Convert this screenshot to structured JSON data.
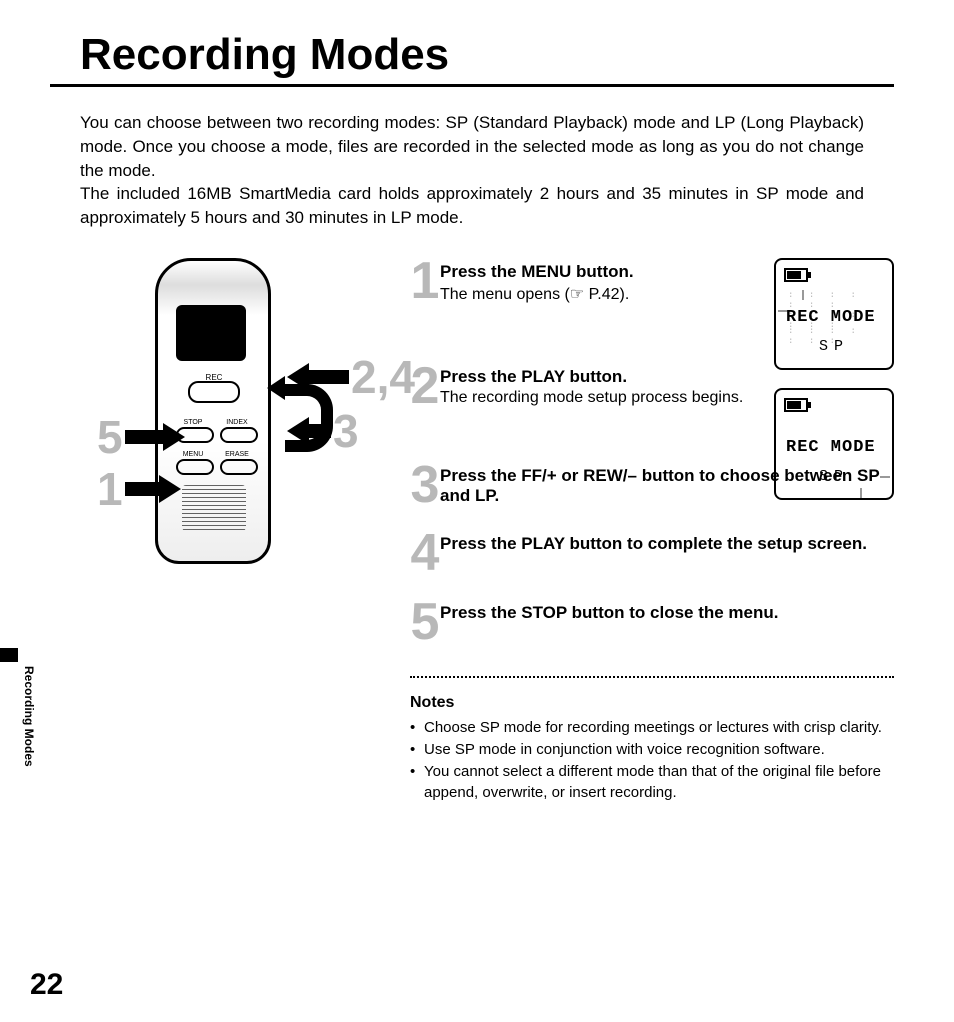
{
  "page_title": "Recording Modes",
  "side_tab": "Recording Modes",
  "intro_p1": "You can choose between two recording modes: SP (Standard Playback) mode and LP (Long Playback) mode. Once you choose a mode, files are recorded in the selected mode as long as you do not change the mode.",
  "intro_p2": "The included 16MB SmartMedia card holds approximately 2 hours and 35 minutes in SP mode and approximately 5 hours and 30 minutes in LP mode.",
  "device_labels": {
    "rec": "REC",
    "stop": "STOP",
    "index": "INDEX",
    "menu": "MENU",
    "erase": "ERASE"
  },
  "callouts": {
    "left_bottom": "1",
    "left_top": "5",
    "right_top": "2,4",
    "right_bottom": "3"
  },
  "steps": [
    {
      "n": "1",
      "h": "Press the MENU button.",
      "d": "The menu opens (☞ P.42)."
    },
    {
      "n": "2",
      "h": "Press the PLAY button.",
      "d": "The recording mode setup process begins."
    },
    {
      "n": "3",
      "h": "Press the FF/+ or REW/– button to choose between SP and LP.",
      "d": ""
    },
    {
      "n": "4",
      "h": "Press the PLAY button to complete the setup screen.",
      "d": ""
    },
    {
      "n": "5",
      "h": "Press the STOP button to close the menu.",
      "d": ""
    }
  ],
  "lcd": {
    "line1": "REC MODE",
    "line2": "SP"
  },
  "notes_header": "Notes",
  "notes": [
    "Choose SP mode for recording meetings or lectures with crisp clarity.",
    "Use SP mode in conjunction with voice recognition software.",
    "You cannot select a different mode than that of the original file before append, overwrite, or insert recording."
  ],
  "page_number": "22"
}
